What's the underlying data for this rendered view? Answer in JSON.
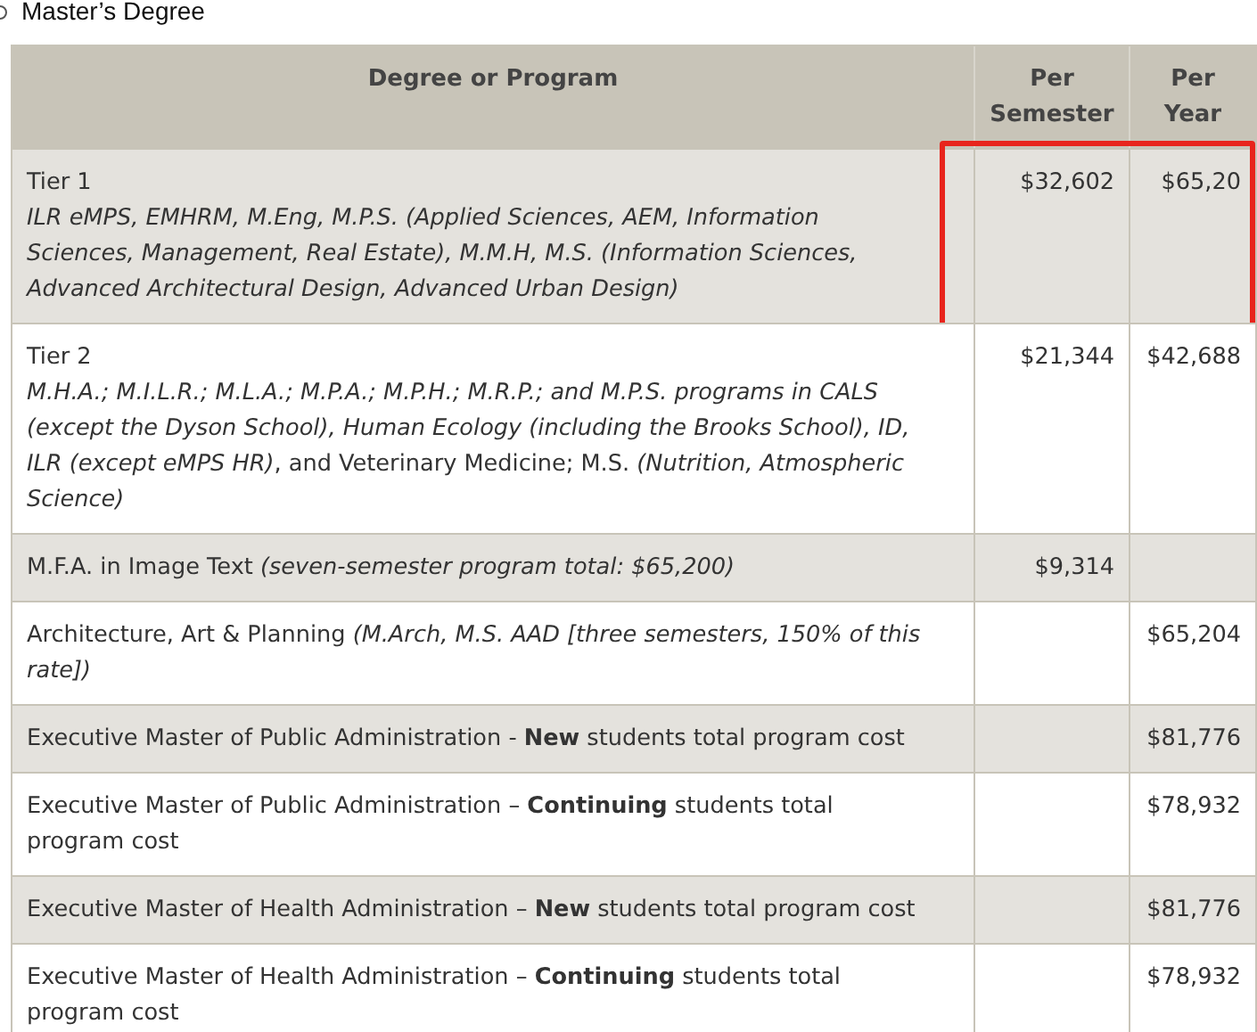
{
  "section_title": "Master’s Degree",
  "table": {
    "columns": [
      "Degree or Program",
      "Per Semester",
      "Per Year"
    ],
    "rows": [
      {
        "title": "Tier 1",
        "detail": "*ILR eMPS, EMHRM, M.Eng, M.P.S. (Applied Sciences, AEM, Information Sciences, Management, Real Estate), M.M.H, M.S. (Information Sciences, Advanced Architectural Design, Advanced Urban Design)*",
        "per_semester": "$32,602",
        "per_year": "$65,20",
        "highlighted": true
      },
      {
        "title": "Tier 2",
        "detail": "*M.H.A.; M.I.L.R.; M.L.A.; M.P.A.; M.P.H.; M.R.P.; and M.P.S. programs in CALS (except the Dyson School), Human Ecology (including the Brooks School), ID, ILR (except eMPS HR)*, and Veterinary Medicine; M.S. *(Nutrition, Atmospheric Science)*",
        "per_semester": "$21,344",
        "per_year": "$42,688",
        "highlighted": false
      },
      {
        "title": "M.F.A. in Image Text *(seven-semester program total: $65,200)*",
        "per_semester": "$9,314",
        "highlighted": false
      },
      {
        "title": "Architecture, Art & Planning *(M.Arch, M.S. AAD [three semesters, 150% of this rate])*",
        "per_year": "$65,204",
        "highlighted": false
      },
      {
        "title": "Executive Master of Public Administration - **New** students total program cost",
        "per_year": "$81,776",
        "highlighted": false
      },
      {
        "title": "Executive Master of Public Administration – **Continuing** students total program cost",
        "per_year": "$78,932",
        "highlighted": false
      },
      {
        "title": "Executive Master of Health Administration – **New** students total program cost",
        "per_year": "$81,776",
        "highlighted": false
      },
      {
        "title": "Executive Master of Health Administration – **Continuing** students total program cost",
        "per_year": "$78,932",
        "highlighted": false
      }
    ]
  }
}
